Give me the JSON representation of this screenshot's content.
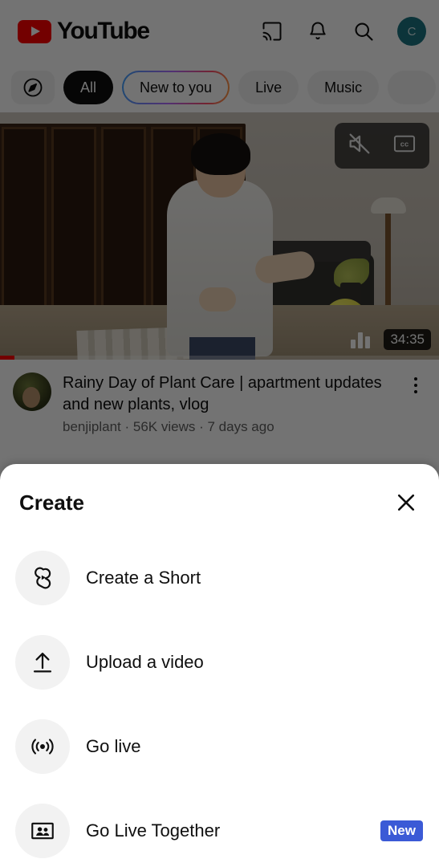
{
  "appbar": {
    "logo_text": "YouTube",
    "logo_color": "#ff0000",
    "cast_icon": "cast-icon",
    "bell_icon": "notifications-bell-icon",
    "search_icon": "search-icon",
    "avatar_letter": "C",
    "avatar_color": "#1b7480"
  },
  "chips": [
    {
      "label": "",
      "icon": "explore-compass-icon",
      "style": "explore"
    },
    {
      "label": "All",
      "style": "selected"
    },
    {
      "label": "New to you",
      "style": "gradient"
    },
    {
      "label": "Live",
      "style": "normal"
    },
    {
      "label": "Music",
      "style": "normal"
    },
    {
      "label": "",
      "style": "partial"
    }
  ],
  "video": {
    "title": "Rainy Day of Plant Care | apartment updates and new plants, vlog",
    "channel": "benjiplant",
    "views": "56K views",
    "age": "7 days ago",
    "subtitle": "benjiplant · 56K views · 7 days ago",
    "duration": "34:35",
    "muted_icon": "muted-speaker-icon",
    "cc_label": "CC",
    "stats_icon": "bar-stats-icon",
    "menu_icon": "kebab-menu-icon"
  },
  "sheet": {
    "title": "Create",
    "close_icon": "close-x-icon",
    "items": [
      {
        "label": "Create a Short",
        "icon": "shorts-icon",
        "badge": ""
      },
      {
        "label": "Upload a video",
        "icon": "upload-arrow-icon",
        "badge": ""
      },
      {
        "label": "Go live",
        "icon": "broadcast-live-icon",
        "badge": ""
      },
      {
        "label": "Go Live Together",
        "icon": "people-frame-icon",
        "badge": "New"
      }
    ],
    "badge_color": "#3b5ad6"
  }
}
